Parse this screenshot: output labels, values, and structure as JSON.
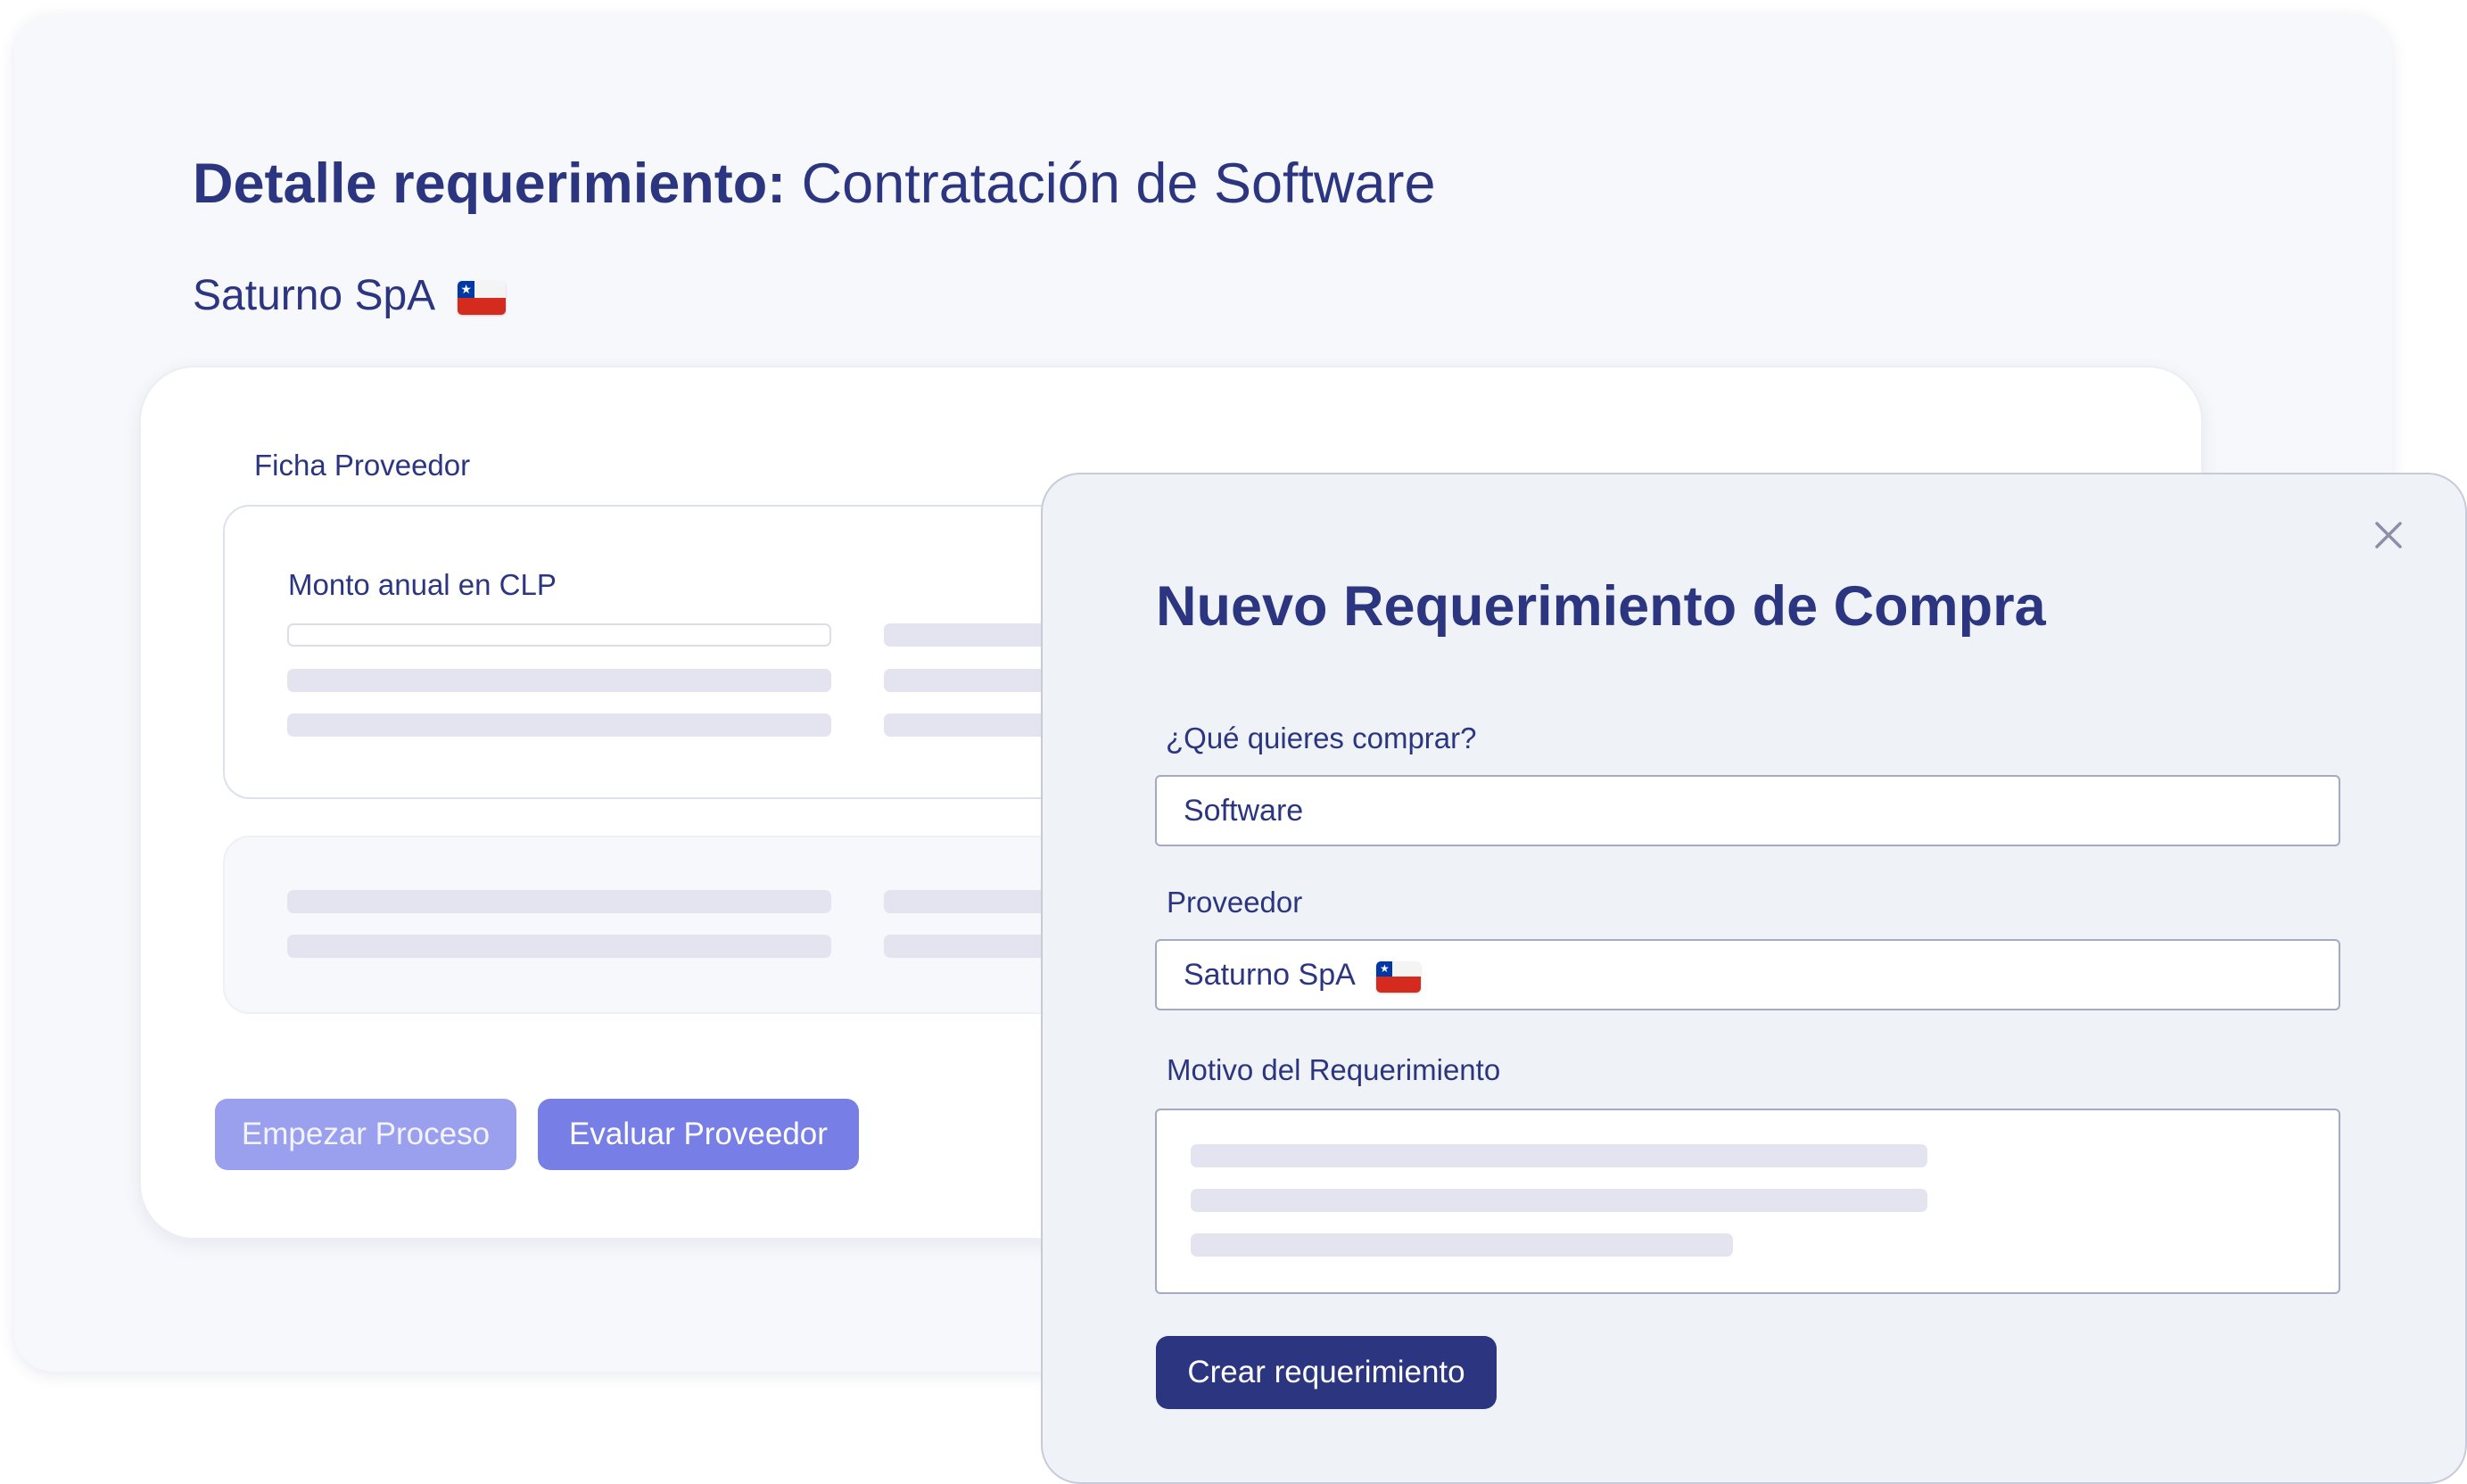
{
  "page": {
    "title_prefix": "Detalle requerimiento: ",
    "title_bold": "Contratación de Software",
    "company_name": "Saturno SpA"
  },
  "supplier_card": {
    "section_label": "Ficha Proveedor",
    "amount_label": "Monto anual en CLP",
    "buttons": {
      "start_label": "Empezar Proceso",
      "evaluate_label": "Evaluar Proveedor"
    }
  },
  "modal": {
    "title": "Nuevo Requerimiento de Compra",
    "fields": {
      "what_label": "¿Qué quieres comprar?",
      "what_value": "Software",
      "supplier_label": "Proveedor",
      "supplier_value": "Saturno SpA",
      "reason_label": "Motivo del Requerimiento"
    },
    "submit_label": "Crear requerimiento"
  },
  "icons": {
    "close": "close-icon",
    "flag": "chile-flag-icon"
  },
  "colors": {
    "text_primary": "#2c3680",
    "button_primary": "#2b3580",
    "button_secondary": "#777fe6",
    "button_disabled": "#9aa0ee",
    "modal_background": "#eff2f6"
  }
}
